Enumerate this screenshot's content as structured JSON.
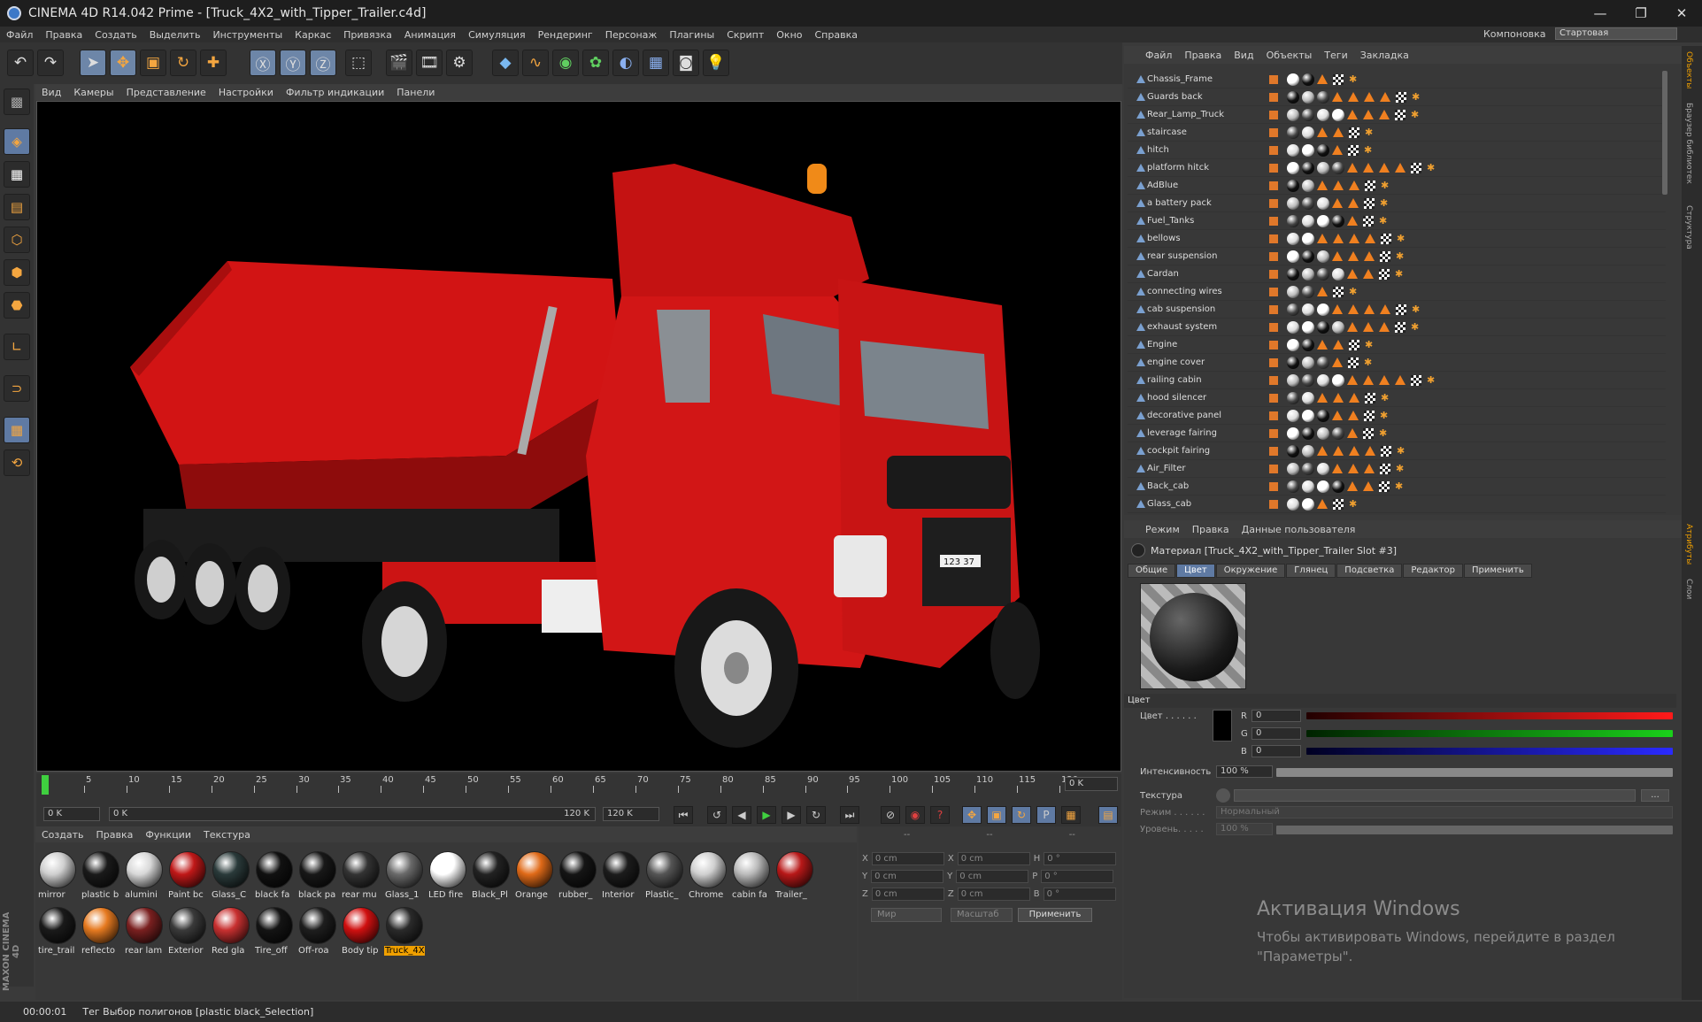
{
  "app": {
    "title": "CINEMA 4D R14.042 Prime - [Truck_4X2_with_Tipper_Trailer.c4d]",
    "minimize": "—",
    "maximize": "❐",
    "close": "✕"
  },
  "menu": [
    "Файл",
    "Правка",
    "Создать",
    "Выделить",
    "Инструменты",
    "Каркас",
    "Привязка",
    "Анимация",
    "Симуляция",
    "Рендеринг",
    "Персонаж",
    "Плагины",
    "Скрипт",
    "Окно",
    "Справка"
  ],
  "layout": {
    "label": "Компоновка",
    "value": "Стартовая"
  },
  "viewport": {
    "menu": [
      "Вид",
      "Камеры",
      "Представление",
      "Настройки",
      "Фильтр индикации",
      "Панели"
    ],
    "plate": "123 37"
  },
  "timeline": {
    "ticks": [
      "0",
      "5",
      "10",
      "15",
      "20",
      "25",
      "30",
      "35",
      "40",
      "45",
      "50",
      "55",
      "60",
      "65",
      "70",
      "75",
      "80",
      "85",
      "90",
      "95",
      "100",
      "105",
      "110",
      "115",
      "120"
    ],
    "current": "0 K",
    "start": "0 K",
    "range_start": "0 K",
    "range_end": "120 K",
    "end": "120 K"
  },
  "material_manager": {
    "menu": [
      "Создать",
      "Правка",
      "Функции",
      "Текстура"
    ],
    "materials": [
      {
        "name": "mirror",
        "color": "#cfcfcf"
      },
      {
        "name": "plastic b",
        "color": "#1a1a1a"
      },
      {
        "name": "alumini",
        "color": "#d8d8d8"
      },
      {
        "name": "Paint bc",
        "color": "#c01818"
      },
      {
        "name": "Glass_C",
        "color": "#2a3a3a"
      },
      {
        "name": "black fa",
        "color": "#111111"
      },
      {
        "name": "black pa",
        "color": "#181818"
      },
      {
        "name": "rear mu",
        "color": "#333333"
      },
      {
        "name": "Glass_1",
        "color": "#6a6a6a"
      },
      {
        "name": "LED fire",
        "color": "#ffffff"
      },
      {
        "name": "Black_Pl",
        "color": "#222222"
      },
      {
        "name": "Orange",
        "color": "#e06a18"
      },
      {
        "name": "rubber_",
        "color": "#151515"
      },
      {
        "name": "Interior",
        "color": "#1c1c1c"
      },
      {
        "name": "Plastic_",
        "color": "#555555"
      },
      {
        "name": "Chrome",
        "color": "#d0d0d0"
      },
      {
        "name": "cabin fa",
        "color": "#bbbbbb"
      },
      {
        "name": "Trailer_",
        "color": "#b81818"
      },
      {
        "name": "tire_trail",
        "color": "#1a1a1a"
      },
      {
        "name": "reflecto",
        "color": "#e67a20"
      },
      {
        "name": "rear lam",
        "color": "#7a2020"
      },
      {
        "name": "Exterior",
        "color": "#3a3a3a"
      },
      {
        "name": "Red gla",
        "color": "#c83030"
      },
      {
        "name": "Tire_off",
        "color": "#141414"
      },
      {
        "name": "Off-roa",
        "color": "#1e1e1e"
      },
      {
        "name": "Body tip",
        "color": "#d01010"
      },
      {
        "name": "Truck_4X",
        "color": "#2a2a2a"
      }
    ]
  },
  "coords": {
    "rows": [
      {
        "a": "X",
        "av": "0 cm",
        "b": "X",
        "bv": "0 cm",
        "c": "H",
        "cv": "0 °"
      },
      {
        "a": "Y",
        "av": "0 cm",
        "b": "Y",
        "bv": "0 cm",
        "c": "P",
        "cv": "0 °"
      },
      {
        "a": "Z",
        "av": "0 cm",
        "b": "Z",
        "bv": "0 cm",
        "c": "B",
        "cv": "0 °"
      }
    ],
    "header": [
      "--",
      "--",
      "--"
    ],
    "world": "Мир",
    "scale": "Масштаб",
    "apply": "Применить"
  },
  "status": {
    "time": "00:00:01",
    "text": "Тег Выбор полигонов [plastic black_Selection]"
  },
  "objects": {
    "menu": [
      "Файл",
      "Правка",
      "Вид",
      "Объекты",
      "Теги",
      "Закладка"
    ],
    "rows": [
      "Chassis_Frame",
      "Guards back",
      "Rear_Lamp_Truck",
      "staircase",
      "hitch",
      "platform hitck",
      "AdBlue",
      "a battery pack",
      "Fuel_Tanks",
      "bellows",
      "rear suspension",
      "Cardan",
      "connecting wires",
      "cab suspension",
      "exhaust system",
      "Engine",
      "engine cover",
      "railing cabin",
      "hood silencer",
      "decorative panel",
      "leverage fairing",
      "cockpit fairing",
      "Air_Filter",
      "Back_cab",
      "Glass_cab"
    ]
  },
  "attributes": {
    "menu": [
      "Режим",
      "Правка",
      "Данные пользователя"
    ],
    "title": "Материал [Truck_4X2_with_Tipper_Trailer Slot #3]",
    "tabs": [
      "Общие",
      "Цвет",
      "Окружение",
      "Глянец",
      "Подсветка",
      "Редактор",
      "Применить"
    ],
    "section": "Цвет",
    "color_label": "Цвет . . . . . .",
    "r": "0",
    "g": "0",
    "b": "0",
    "intensity_label": "Интенсивность",
    "intensity": "100 %",
    "texture_label": "Текстура",
    "mode_label": "Режим . . . . . .",
    "mode_value": "Нормальный",
    "level_label": "Уровень. . . . .",
    "level_value": "100 %"
  },
  "right_strip": [
    "Объекты",
    "Браузер библиотек",
    "Структура",
    "Атрибуты",
    "Слои"
  ],
  "activation": {
    "title": "Активация Windows",
    "text1": "Чтобы активировать Windows, перейдите в раздел",
    "text2": "\"Параметры\"."
  }
}
